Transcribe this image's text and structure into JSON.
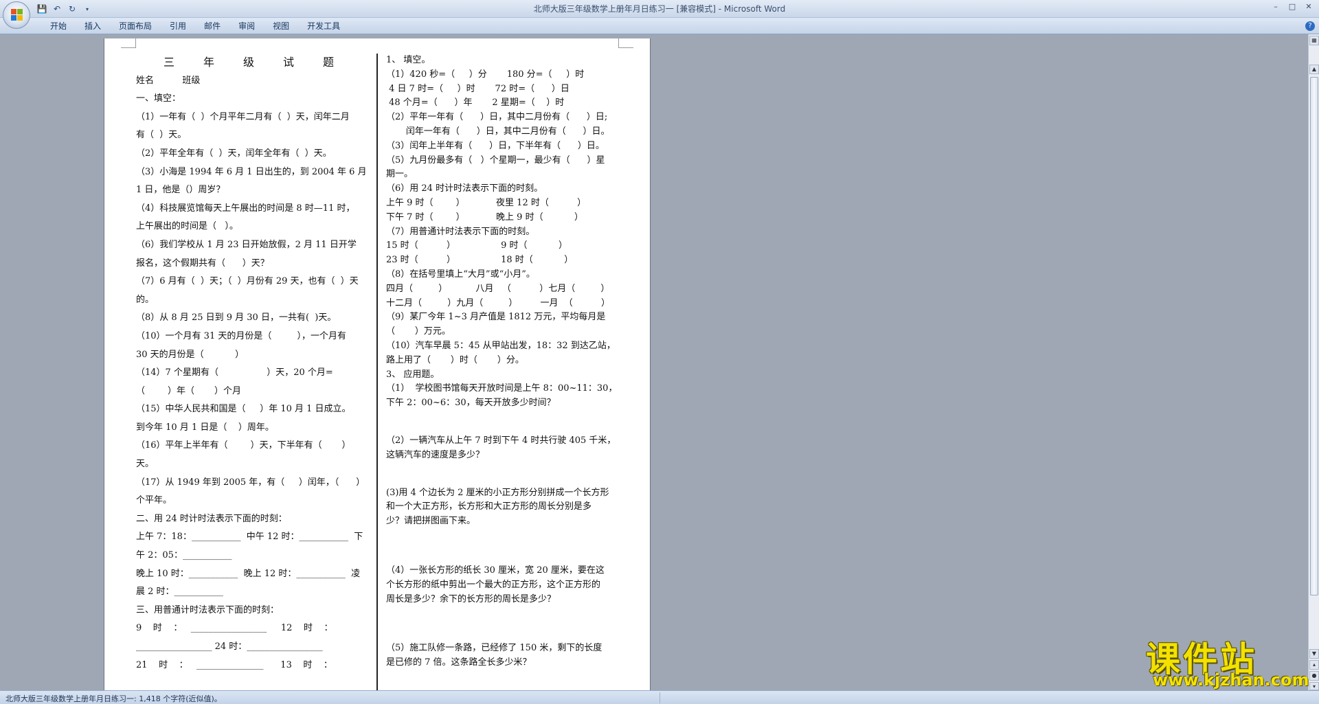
{
  "window": {
    "title": "北师大版三年级数学上册年月日练习一 [兼容模式] - Microsoft Word",
    "controls": [
      "minimize-icon",
      "restore-icon",
      "close-icon"
    ]
  },
  "quick_access": {
    "save_icon": "save-icon",
    "undo_icon": "undo-icon",
    "redo_icon": "redo-icon",
    "customize_icon": "dropdown-icon"
  },
  "ribbon": {
    "tabs": [
      "开始",
      "插入",
      "页面布局",
      "引用",
      "邮件",
      "审阅",
      "视图",
      "开发工具"
    ]
  },
  "document": {
    "left_lines": [
      "三年级试题",
      "姓名          班级",
      "一、填空：",
      "（1）一年有（  ）个月平年二月有（  ）天，闰年二月",
      "有（  ）天。",
      "（2）平年全年有（  ）天，闰年全年有（  ）天。",
      "（3）小海是 1994 年 6 月 1 日出生的，到 2004 年 6 月",
      "1 日，他是（）周岁？",
      "（4）科技展览馆每天上午展出的时间是 8 时—11 时，",
      "上午展出的时间是（   ）。",
      "（6）我们学校从 1 月 23 日开始放假，2 月 11 日开学",
      "报名，这个假期共有（      ）天？",
      "（7）6 月有（  ）天；（  ）月份有 29 天，也有（  ）天",
      "的。",
      "（8）从 8 月 25 日到 9 月 30 日，一共有(  )天。",
      "（10）一个月有 31 天的月份是（         ），一个月有",
      "30 天的月份是（           ）",
      "（14）7 个星期有（                 ）天，20 个月=",
      "（        ）年（       ）个月",
      "（15）中华人民共和国是（     ）年 10 月 1 日成立。",
      "到今年 10 月 1 日是（    ）周年。",
      "（16）平年上半年有（        ）天，下半年有（       ）",
      "天。",
      "（17）从 1949 年到 2005 年，有（     ）闰年，（      ）",
      "个平年。",
      "二、用 24 时计时法表示下面的时刻：",
      "上午 7：18：___________  中午 12 时：___________  下",
      "午 2：05：___________",
      "晚上 10 时：___________  晚上 12 时：___________  凌",
      "晨 2 时：___________",
      "三、用普通计时法表示下面的时刻：",
      "9    时    ：   _________________     12    时    ：",
      "_________________ 24 时：_________________",
      "21    时    ：   _______________      13    时    ："
    ],
    "right_lines": [
      "1、 填空。",
      "（1）420 秒=（     ）分       180 分=（     ）时",
      " 4 日 7 时=（     ）时       72 时=（      ）日",
      " 48 个月=（      ）年       2 星期=（    ）时",
      "（2）平年一年有（      ）日，其中二月份有（      ）日;",
      "       闰年一年有（      ）日，其中二月份有（      ）日。",
      "（3）闰年上半年有（      ）日，下半年有（      ）日。",
      "（5）九月份最多有（   ）个星期一，最少有（      ）星",
      "期一。",
      "（6）用 24 时计时法表示下面的时刻。",
      "上午 9 时（        ）           夜里 12 时（          ）",
      "下午 7 时（        ）           晚上 9 时（           ）",
      "（7）用普通计时法表示下面的时刻。",
      "15 时（          ）                9 时（           ）",
      "23 时（          ）                18 时（           ）",
      "（8）在括号里填上“大月”或“小月”。",
      "四月（         ）          八月   （          ）七月（         ）",
      "十二月（         ）九月（         ）        一月  （          ）",
      "（9）某厂今年 1~3 月产值是 1812 万元，平均每月是",
      "（       ）万元。",
      "（10）汽车早晨 5：45 从甲站出发，18：32 到达乙站，",
      "路上用了（       ）时（       ）分。",
      "3、 应用题。",
      "（1）  学校图书馆每天开放时间是上午 8：00~11：30，",
      "下午 2：00~6：30，每天开放多少时间？",
      "",
      "",
      "（2）一辆汽车从上午 7 时到下午 4 时共行驶 405 千米，",
      "这辆汽车的速度是多少？",
      "",
      "",
      "(3)用 4 个边长为 2 厘米的小正方形分别拼成一个长方形",
      "和一个大正方形，长方形和大正方形的周长分别是多",
      "少？请把拼图画下来。",
      "",
      "",
      "",
      "（4）一张长方形的纸长 30 厘米，宽 20 厘米，要在这",
      "个长方形的纸中剪出一个最大的正方形，这个正方形的",
      "周长是多少？余下的长方形的周长是多少？",
      "",
      "",
      "",
      "（5）施工队修一条路，已经修了 150 米，剩下的长度",
      "是已修的 7 倍。这条路全长多少米？"
    ]
  },
  "statusbar": {
    "text": "北师大版三年级数学上册年月日练习一: 1,418 个字符(近似值)。"
  },
  "watermark": {
    "main": "课件站",
    "url": "www.kjzhan.com"
  },
  "colors": {
    "workspace": "#9ea7b3",
    "ribbon": "#c5d4e8",
    "logo": "#f3e200"
  }
}
